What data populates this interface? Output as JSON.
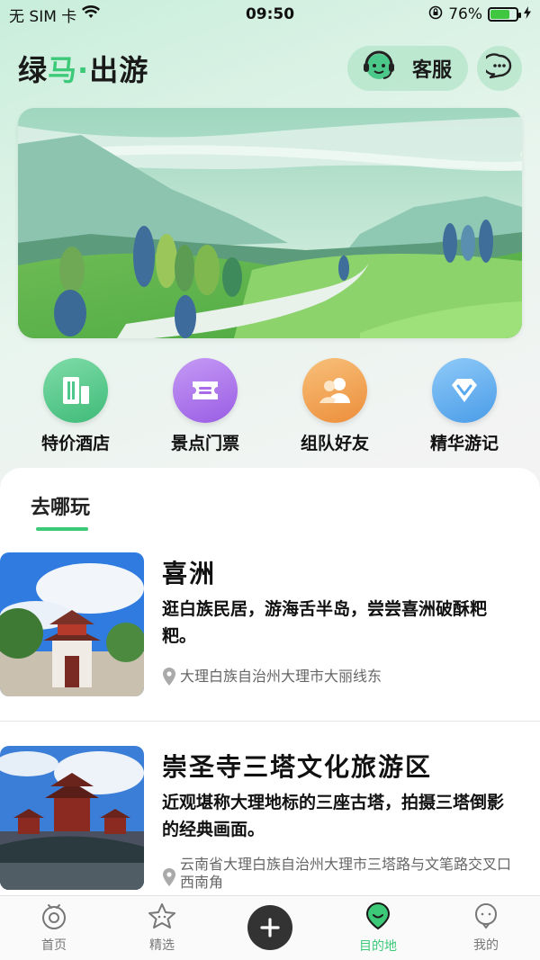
{
  "status_bar": {
    "carrier": "无 SIM 卡",
    "time": "09:50",
    "battery_percent": "76%",
    "battery_level": 0.76
  },
  "header": {
    "brand_part1": "绿",
    "brand_accent": "马",
    "brand_dot": "·",
    "brand_part2": "出游",
    "service_label": "客服"
  },
  "quick_menu": [
    {
      "label": "特价酒店",
      "icon": "hotel-icon",
      "color": "#4cc98a"
    },
    {
      "label": "景点门票",
      "icon": "ticket-icon",
      "color": "#a86ae8"
    },
    {
      "label": "组队好友",
      "icon": "friends-icon",
      "color": "#f0a04c"
    },
    {
      "label": "精华游记",
      "icon": "diamond-icon",
      "color": "#5aaaf0"
    }
  ],
  "section": {
    "title": "去哪玩"
  },
  "places": [
    {
      "name": "喜洲",
      "description": "逛白族民居，游海舌半岛，尝尝喜洲破酥粑粑。",
      "location": "大理白族自治州大理市大丽线东"
    },
    {
      "name": "崇圣寺三塔文化旅游区",
      "description": "近观堪称大理地标的三座古塔，拍摄三塔倒影的经典画面。",
      "location": "云南省大理白族自治州大理市三塔路与文笔路交叉口西南角"
    }
  ],
  "tab_bar": [
    {
      "label": "首页",
      "icon": "home-eye-icon"
    },
    {
      "label": "精选",
      "icon": "star-icon"
    },
    {
      "label": "",
      "icon": "plus-icon"
    },
    {
      "label": "目的地",
      "icon": "destination-icon",
      "active": true
    },
    {
      "label": "我的",
      "icon": "profile-icon"
    }
  ],
  "colors": {
    "accent": "#3cc978",
    "dark": "#333333"
  }
}
